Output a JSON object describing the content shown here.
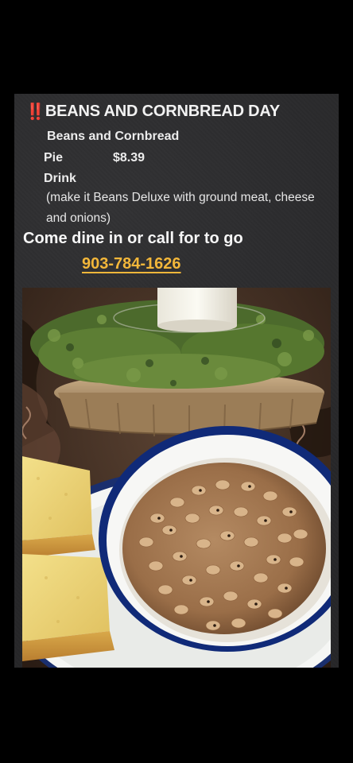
{
  "post": {
    "alert_icon": "‼️",
    "title": "BEANS AND CORNBREAD DAY",
    "menu": {
      "item_1": "Beans and Cornbread",
      "item_2": "Pie",
      "price": "$8.39",
      "item_3": "Drink",
      "note": "(make it Beans Deluxe with ground meat, cheese and onions)"
    },
    "call_to_action": "Come dine in or call for to go",
    "phone": "903-784-1626"
  },
  "colors": {
    "background": "#000000",
    "card": "#2a2a2c",
    "text": "#f2f2f2",
    "phone": "#f3b73a",
    "alert": "#e0252b"
  }
}
